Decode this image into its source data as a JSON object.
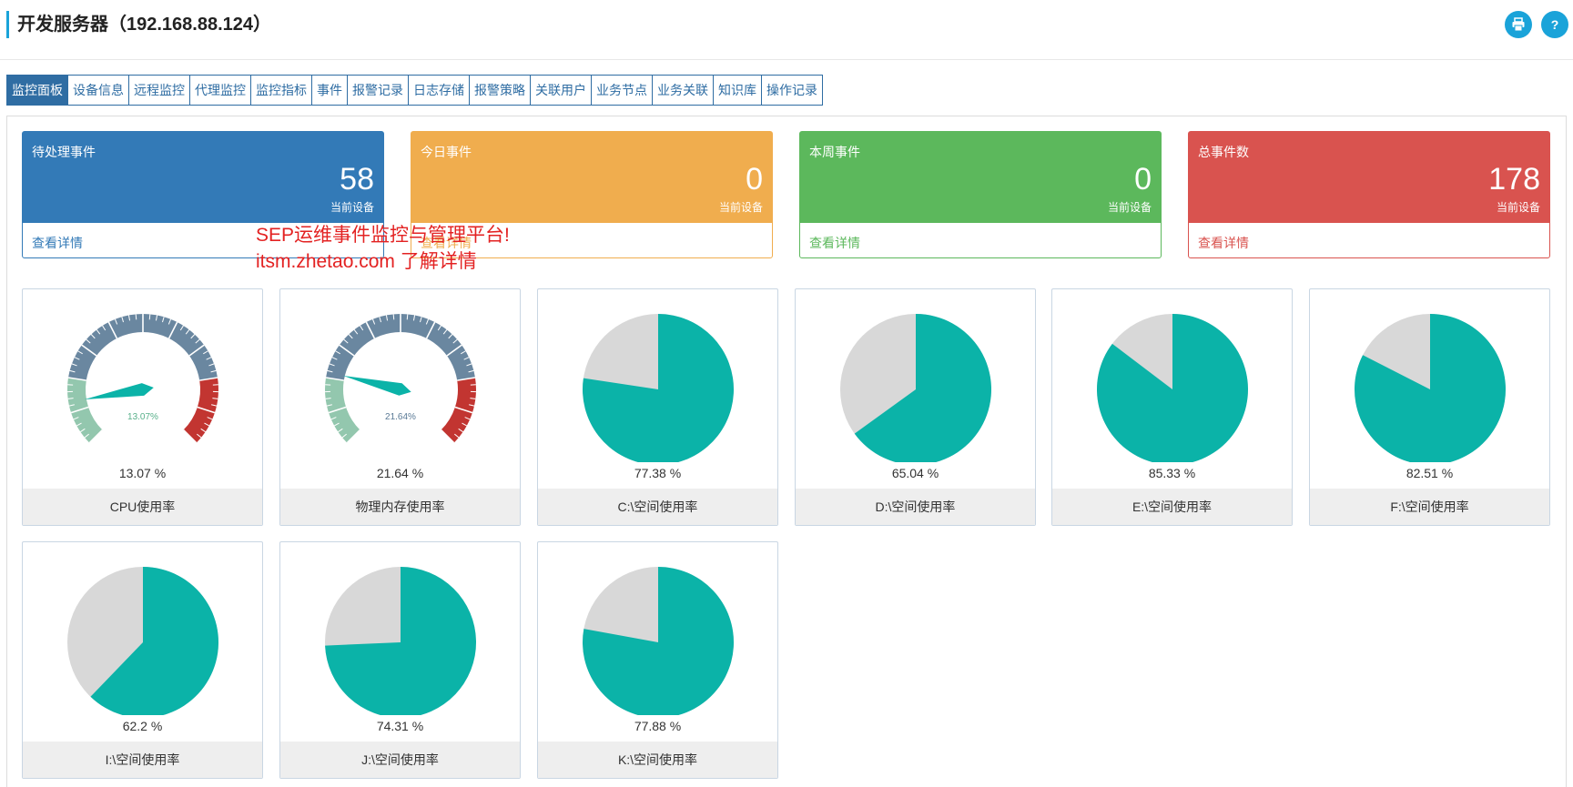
{
  "header": {
    "title": "开发服务器（192.168.88.124）",
    "print_label": "",
    "help_label": "?"
  },
  "tabs": [
    "监控面板",
    "设备信息",
    "远程监控",
    "代理监控",
    "监控指标",
    "事件",
    "报警记录",
    "日志存储",
    "报警策略",
    "关联用户",
    "业务节点",
    "业务关联",
    "知识库",
    "操作记录"
  ],
  "active_tab": 0,
  "stats": [
    {
      "label": "待处理事件",
      "value": "58",
      "sub": "当前设备",
      "detail": "查看详情",
      "color": "#337ab7"
    },
    {
      "label": "今日事件",
      "value": "0",
      "sub": "当前设备",
      "detail": "查看详情",
      "color": "#f0ad4e"
    },
    {
      "label": "本周事件",
      "value": "0",
      "sub": "当前设备",
      "detail": "查看详情",
      "color": "#5cb85c"
    },
    {
      "label": "总事件数",
      "value": "178",
      "sub": "当前设备",
      "detail": "查看详情",
      "color": "#d9534f"
    }
  ],
  "gauges": [
    {
      "name": "CPU使用率",
      "value": 13.07,
      "pct_text": "13.07 %",
      "inner_text": "13.07%"
    },
    {
      "name": "物理内存使用率",
      "value": 21.64,
      "pct_text": "21.64 %",
      "inner_text": "21.64%"
    }
  ],
  "disks": [
    {
      "name": "C:\\空间使用率",
      "value": 77.38,
      "pct_text": "77.38 %"
    },
    {
      "name": "D:\\空间使用率",
      "value": 65.04,
      "pct_text": "65.04 %"
    },
    {
      "name": "E:\\空间使用率",
      "value": 85.33,
      "pct_text": "85.33 %"
    },
    {
      "name": "F:\\空间使用率",
      "value": 82.51,
      "pct_text": "82.51 %"
    },
    {
      "name": "I:\\空间使用率",
      "value": 62.2,
      "pct_text": "62.2 %"
    },
    {
      "name": "J:\\空间使用率",
      "value": 74.31,
      "pct_text": "74.31 %"
    },
    {
      "name": "K:\\空间使用率",
      "value": 77.88,
      "pct_text": "77.88 %"
    }
  ],
  "colors": {
    "accent": "#1aa3d9",
    "tab": "#2f6da3",
    "pie_used": "#0bb3a8",
    "pie_free": "#d8d8d8",
    "gauge_mid": "#6a87a0",
    "gauge_low": "#93c7ae",
    "gauge_high": "#c23531",
    "pointer": "#0bb3a8"
  },
  "promo": {
    "line1": "SEP运维事件监控与管理平台!",
    "line2": "itsm.zhetao.com 了解详情"
  }
}
